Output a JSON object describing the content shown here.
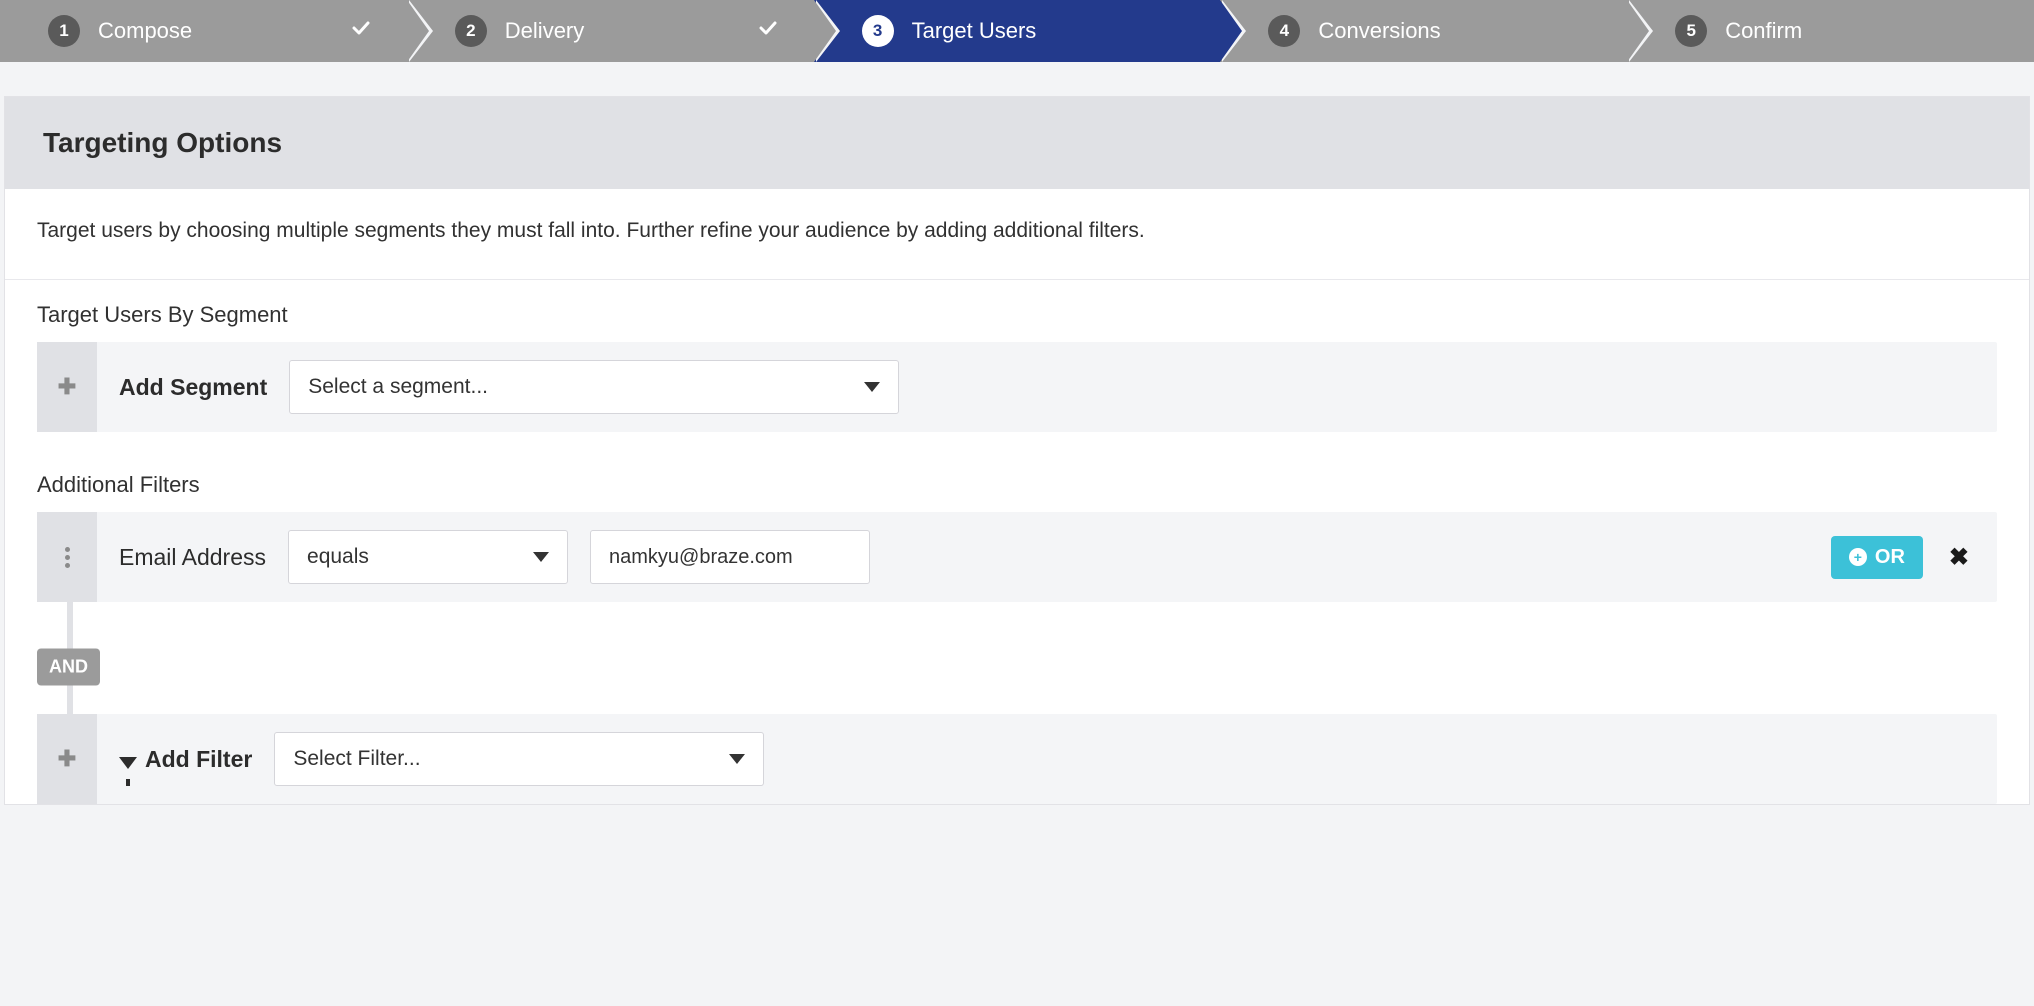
{
  "stepper": {
    "steps": [
      {
        "num": "1",
        "label": "Compose",
        "state": "done"
      },
      {
        "num": "2",
        "label": "Delivery",
        "state": "done"
      },
      {
        "num": "3",
        "label": "Target Users",
        "state": "active"
      },
      {
        "num": "4",
        "label": "Conversions",
        "state": "upcoming"
      },
      {
        "num": "5",
        "label": "Confirm",
        "state": "upcoming"
      }
    ]
  },
  "panel": {
    "title": "Targeting Options",
    "description": "Target users by choosing multiple segments they must fall into. Further refine your audience by adding additional filters."
  },
  "segment": {
    "section_title": "Target Users By Segment",
    "row_label": "Add Segment",
    "select_placeholder": "Select a segment..."
  },
  "filters": {
    "section_title": "Additional Filters",
    "items": [
      {
        "attribute_label": "Email Address",
        "operator": "equals",
        "value": "namkyu@braze.com"
      }
    ],
    "or_button": "OR",
    "and_label": "AND",
    "add_filter_label": "Add Filter",
    "add_filter_placeholder": "Select Filter..."
  }
}
